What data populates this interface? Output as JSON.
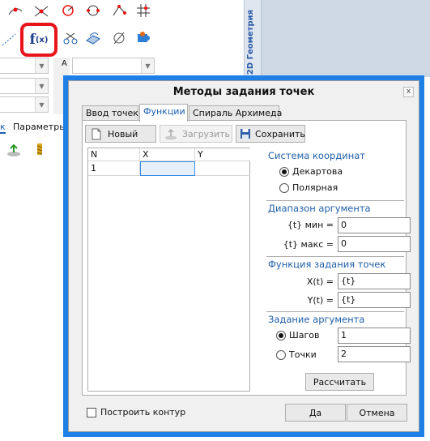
{
  "background_app": {
    "side_panel_label": "2D Геометрия",
    "left_labels": {
      "tab1": "к",
      "tab2": "Параметры",
      "combo_a": "A"
    },
    "fx_button": {
      "main": "f",
      "sub": "(x)"
    }
  },
  "dialog": {
    "title": "Методы задания точек",
    "close": "x",
    "tabs": [
      {
        "label": "Ввод точек",
        "active": false
      },
      {
        "label": "Функции",
        "active": true
      },
      {
        "label": "Спираль Архимеда",
        "active": false
      }
    ],
    "toolbar": {
      "new_label": "Новый",
      "load_label": "Загрузить",
      "save_label": "Сохранить"
    },
    "table": {
      "columns": [
        "N",
        "X",
        "Y"
      ],
      "rows": [
        {
          "n": "1",
          "x": "",
          "y": ""
        }
      ]
    },
    "coord_system": {
      "title": "Система координат",
      "options": [
        {
          "label": "Декартова",
          "selected": true
        },
        {
          "label": "Полярная",
          "selected": false
        }
      ]
    },
    "arg_range": {
      "title": "Диапазон аргумента",
      "min_label": "{t} мин =",
      "min_value": "0",
      "max_label": "{t} макс =",
      "max_value": "0"
    },
    "point_function": {
      "title": "Функция задания точек",
      "x_label": "X(t) =",
      "x_value": "{t}",
      "y_label": "Y(t) =",
      "y_value": "{t}"
    },
    "arg_setting": {
      "title": "Задание аргумента",
      "steps_label": "Шагов",
      "steps_value": "1",
      "steps_selected": true,
      "points_label": "Точки",
      "points_value": "2",
      "points_selected": false
    },
    "calc_label": "Рассчитать",
    "contour_label": "Построить контур",
    "ok_label": "Да",
    "cancel_label": "Отмена"
  },
  "colors": {
    "highlight_red": "#e8141c",
    "frame_blue": "#1e7fe6",
    "section_blue": "#1f5ea8"
  }
}
